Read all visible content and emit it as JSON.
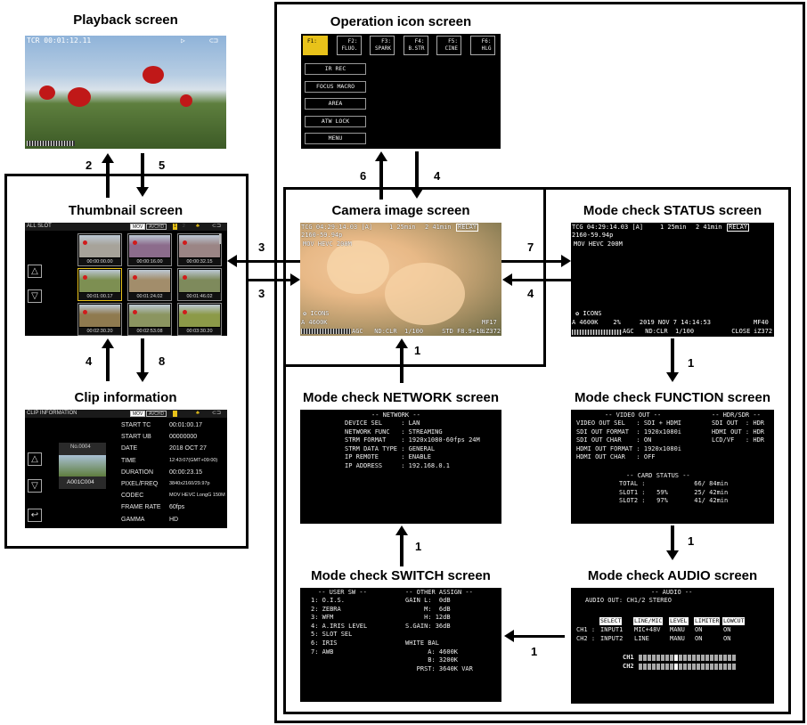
{
  "titles": {
    "playback": "Playback screen",
    "thumbnail": "Thumbnail screen",
    "clip_info": "Clip information",
    "operation": "Operation icon screen",
    "camera": "Camera image screen",
    "status": "Mode check STATUS screen",
    "network": "Mode check NETWORK screen",
    "function": "Mode check FUNCTION screen",
    "switch": "Mode check SWITCH screen",
    "audio": "Mode check AUDIO screen"
  },
  "arrows": {
    "playback_to_thumb": "2",
    "thumb_to_playback": "5",
    "thumb_camera_top": "3",
    "thumb_camera_bottom": "3",
    "thumb_to_clip": "8",
    "clip_to_thumb": "4",
    "camera_to_operation": "6",
    "operation_to_camera": "4",
    "camera_to_status": "7",
    "status_to_camera": "4",
    "status_to_function": "1",
    "function_to_audio": "1",
    "audio_to_switch": "1",
    "switch_to_network": "1",
    "network_to_camera": "1"
  },
  "playback": {
    "tcr": "TCR 00:01:12.11",
    "play_icon": "▷",
    "battery_icon": "⊂⊐"
  },
  "thumbnail": {
    "slot": "ALL SLOT",
    "tabs": [
      "MOV",
      "AVCHD"
    ],
    "slot1": "1",
    "slot2": "2",
    "up": "△",
    "down": "▽",
    "clips": [
      {
        "tc": "00:00:00.00",
        "color": "#a7a39a"
      },
      {
        "tc": "00:00:16.00",
        "color": "#8c6c8c"
      },
      {
        "tc": "00:00:32.15",
        "color": "#9b8585"
      },
      {
        "tc": "00:01:00.17",
        "color": "#7d8f52",
        "selected": true
      },
      {
        "tc": "00:01:24.02",
        "color": "#a28d6b"
      },
      {
        "tc": "00:01:46.02",
        "color": "#7e8a5c"
      },
      {
        "tc": "00:02:30.20",
        "color": "#8f7a4f"
      },
      {
        "tc": "00:02:53.08",
        "color": "#8b9560"
      },
      {
        "tc": "00:03:30.20",
        "color": "#8c9a48"
      }
    ]
  },
  "clip_info": {
    "header": "CLIP INFORMATION",
    "tabs": [
      "MOV",
      "AVCHD"
    ],
    "clip_no": "No.0004",
    "clip_name": "A001C004",
    "fields": [
      {
        "label": "START TC",
        "value": "00:01:00.17"
      },
      {
        "label": "START UB",
        "value": "00000000"
      },
      {
        "label": "DATE",
        "value": "2018 OCT 27"
      },
      {
        "label": "TIME",
        "value": "12:43:07(GMT+09:00)"
      },
      {
        "label": "DURATION",
        "value": "00:00:23.15"
      },
      {
        "label": "PIXEL/FREQ",
        "value": "3840x2160/29.97p"
      },
      {
        "label": "CODEC",
        "value": "MOV HEVC LongG 150M"
      },
      {
        "label": "FRAME RATE",
        "value": "60fps"
      },
      {
        "label": "GAMMA",
        "value": "HD"
      }
    ],
    "up": "△",
    "down": "▽",
    "back": "↩"
  },
  "operation": {
    "fkeys": [
      {
        "top": "F1:",
        "bottom": ""
      },
      {
        "top": "F2:",
        "bottom": "FLUO."
      },
      {
        "top": "F3:",
        "bottom": "SPARK"
      },
      {
        "top": "F4:",
        "bottom": "B.STR"
      },
      {
        "top": "F5:",
        "bottom": "CINE"
      },
      {
        "top": "F6:",
        "bottom": "HLG"
      }
    ],
    "buttons": [
      "IR REC",
      "FOCUS MACRO",
      "AREA",
      "ATW LOCK",
      "MENU"
    ]
  },
  "camera": {
    "line1": "TCG 04:29:14.03 [A]",
    "slot1": "1 25min",
    "slot2": "2 41min",
    "relay": "RELAY",
    "line2": "2160-59.94p",
    "line3": "MOV HEVC 200M",
    "icons": "✿ ICONS",
    "wb": "A 4600K",
    "mf": "MF17",
    "bottom": "AGC   ND:CLR  1/100     STD F8.9+10",
    "zoom": "iZ372"
  },
  "status": {
    "line1": "TCG 04:29:14.03 [A]",
    "slot1": "1 25min",
    "slot2": "2 41min",
    "relay": "RELAY",
    "line2": "2160-59.94p",
    "line3": "MOV HEVC 200M",
    "icons": "✿ ICONS",
    "wb_line": "A 4600K    2%     2019 NOV 7 14:14:53",
    "mf": "MF40",
    "bottom": "AGC   ND:CLR  1/100          CLOSE",
    "zoom": "iZ372"
  },
  "function": {
    "video_header": "-- VIDEO OUT --",
    "video_rows": [
      "VIDEO OUT SEL   : SDI + HDMI",
      "SDI OUT FORMAT  : 1920x1080i",
      "SDI OUT CHAR    : ON",
      "HDMI OUT FORMAT : 1920x1080i",
      "HDMI OUT CHAR   : OFF"
    ],
    "hdr_header": "-- HDR/SDR --",
    "hdr_rows": [
      "SDI OUT  : HDR",
      "HDMI OUT : HDR",
      "LCD/VF   : HDR"
    ],
    "card_header": "-- CARD STATUS --",
    "card_rows": [
      "TOTAL :             66/ 84min",
      "SLOT1 :   59%       25/ 42min",
      "SLOT2 :   97%       41/ 42min"
    ]
  },
  "network": {
    "header": "-- NETWORK --",
    "rows": [
      "DEVICE SEL     : LAN",
      "NETWORK FUNC   : STREAMING",
      "STRM FORMAT    : 1920x1080-60fps 24M",
      "STRM DATA TYPE : GENERAL",
      "IP REMOTE      : ENABLE",
      "IP ADDRESS     : 192.168.0.1"
    ]
  },
  "switch": {
    "user_header": "-- USER SW --",
    "user_rows": [
      "1: O.I.S.",
      "2: ZEBRA",
      "3: WFM",
      "4: A.IRIS LEVEL",
      "5: SLOT SEL",
      "6: IRIS",
      "7: AWB"
    ],
    "other_header": "-- OTHER ASSIGN --",
    "other_rows": [
      "GAIN L:  0dB",
      "     M:  6dB",
      "     H: 12dB",
      "S.GAIN: 36dB",
      "",
      "WHITE BAL",
      "      A: 4600K",
      "      B: 3200K",
      "   PRST: 3640K VAR"
    ]
  },
  "audio": {
    "header": "-- AUDIO --",
    "out": "AUDIO OUT: CH1/2 STEREO",
    "columns": [
      "SELECT",
      "LINE/MIC",
      "LEVEL",
      "LIMITER",
      "LOWCUT"
    ],
    "rows": [
      {
        "ch": "CH1 :",
        "values": [
          "INPUT1",
          "MIC+48V",
          "MANU",
          "ON",
          "ON"
        ]
      },
      {
        "ch": "CH2 :",
        "values": [
          "INPUT2",
          "LINE",
          "MANU",
          "ON",
          "ON"
        ]
      }
    ],
    "meters": [
      "CH1",
      "CH2"
    ]
  }
}
